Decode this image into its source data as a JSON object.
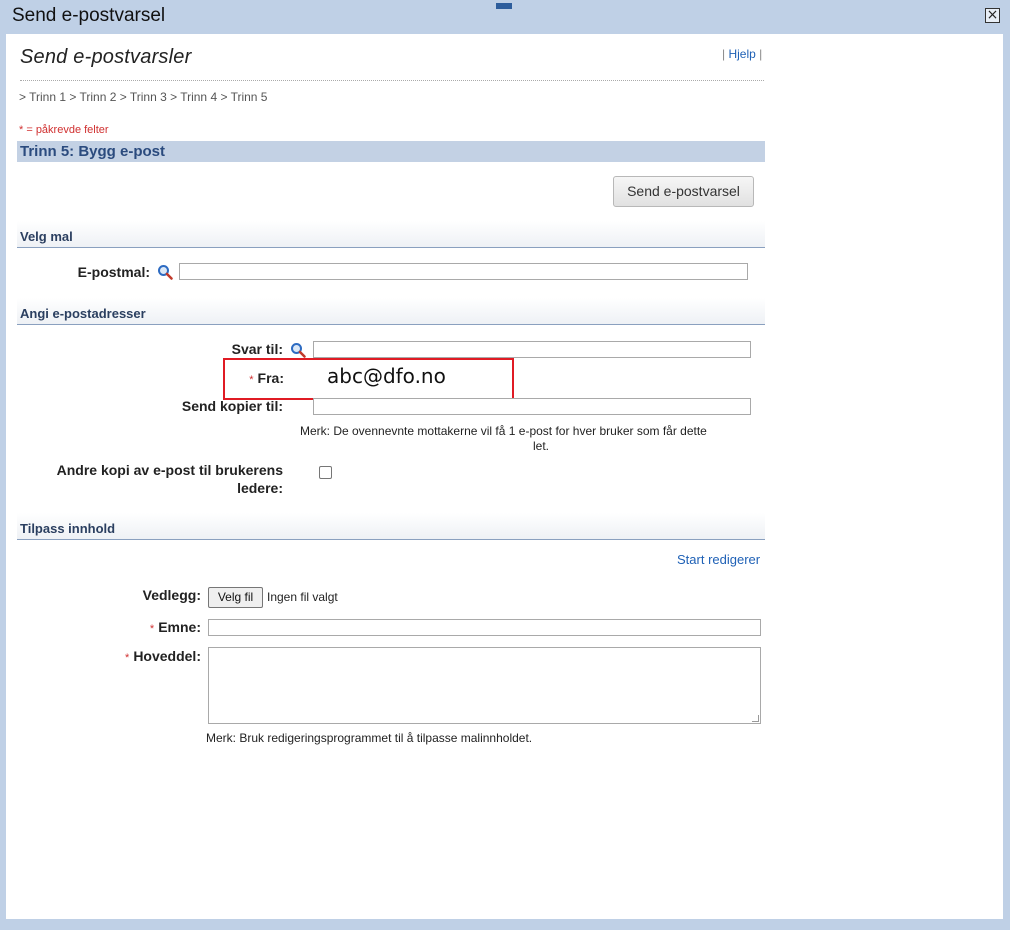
{
  "window": {
    "title": "Send e-postvarsel",
    "close_symbol": "×"
  },
  "page": {
    "heading": "Send e-postvarsler",
    "help_link": "Hjelp",
    "breadcrumb": "> Trinn 1 > Trinn 2 > Trinn 3 > Trinn 4 > Trinn 5",
    "required_note": "* = påkrevde felter",
    "step_title": "Trinn 5: Bygg e-post",
    "send_button": "Send e-postvarsel"
  },
  "section_template": {
    "title": "Velg mal",
    "email_template_label": "E-postmal:",
    "email_template_value": ""
  },
  "section_addresses": {
    "title": "Angi e-postadresser",
    "reply_to_label": "Svar til:",
    "reply_to_value": "",
    "from_label": "Fra:",
    "from_value": "abc@dfo.no",
    "cc_label": "Send kopier til:",
    "cc_value": "",
    "note_line1": "Merk: De ovennevnte mottakerne vil få 1 e-post for hver bruker som får dette",
    "note_line2": "let.",
    "manager_copy_label_line1": "Andre kopi av e-post til brukerens",
    "manager_copy_label_line2": "ledere:",
    "manager_copy_checked": false
  },
  "section_content": {
    "title": "Tilpass innhold",
    "start_editor_link": "Start redigerer",
    "attachment_label": "Vedlegg:",
    "choose_file_button": "Velg fil",
    "no_file_text": "Ingen fil valgt",
    "subject_label": "Emne:",
    "subject_value": "",
    "body_label": "Hoveddel:",
    "body_value": "",
    "editor_note": "Merk: Bruk redigeringsprogrammet til å tilpasse malinnholdet."
  },
  "colors": {
    "background": "#bfd0e6",
    "step_header": "#c3d1e4",
    "link": "#1f61b6",
    "required": "#d03030",
    "highlight_box": "#e01b24"
  },
  "icons": [
    "close-icon",
    "search-icon"
  ]
}
